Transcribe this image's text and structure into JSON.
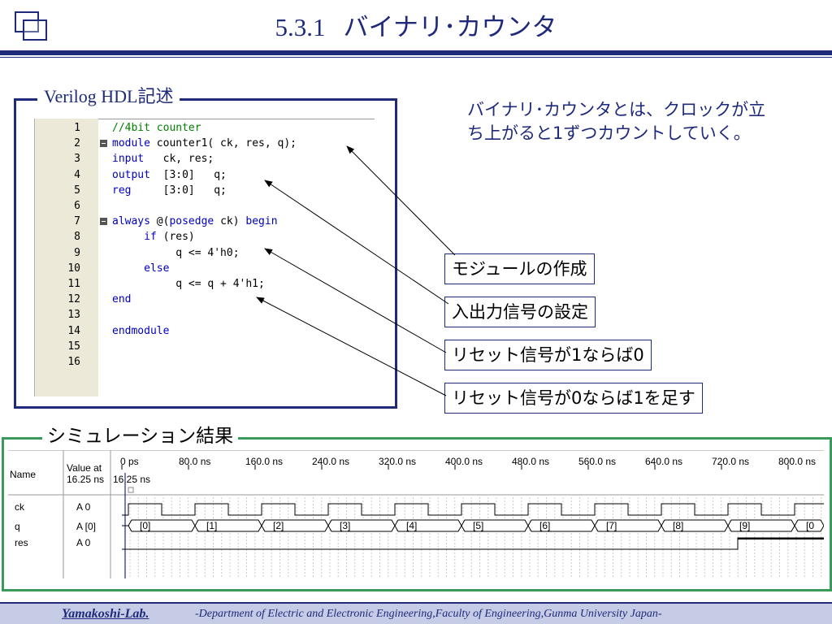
{
  "slide": {
    "number": "5.3.1",
    "title": "バイナリ･カウンタ"
  },
  "verilog_section": {
    "heading": "Verilog HDL記述",
    "lines": [
      {
        "num": "1",
        "parts": [
          {
            "t": "//4bit counter",
            "c": "cm"
          }
        ],
        "fold": false
      },
      {
        "num": "2",
        "parts": [
          {
            "t": "module",
            "c": "kw"
          },
          {
            "t": " counter1( ck, res, q);",
            "c": "tx"
          }
        ],
        "fold": true
      },
      {
        "num": "3",
        "parts": [
          {
            "t": "input",
            "c": "kw"
          },
          {
            "t": "   ck, res;",
            "c": "tx"
          }
        ],
        "fold": false
      },
      {
        "num": "4",
        "parts": [
          {
            "t": "output",
            "c": "kw"
          },
          {
            "t": "  [3:0]   q;",
            "c": "tx"
          }
        ],
        "fold": false
      },
      {
        "num": "5",
        "parts": [
          {
            "t": "reg",
            "c": "kw"
          },
          {
            "t": "     [3:0]   q;",
            "c": "tx"
          }
        ],
        "fold": false
      },
      {
        "num": "6",
        "parts": [],
        "fold": false
      },
      {
        "num": "7",
        "parts": [
          {
            "t": "always",
            "c": "kw"
          },
          {
            "t": " @(",
            "c": "tx"
          },
          {
            "t": "posedge",
            "c": "kw"
          },
          {
            "t": " ck) ",
            "c": "tx"
          },
          {
            "t": "begin",
            "c": "kw"
          }
        ],
        "fold": true
      },
      {
        "num": "8",
        "parts": [
          {
            "t": "     ",
            "c": "tx"
          },
          {
            "t": "if",
            "c": "kw"
          },
          {
            "t": " (res)",
            "c": "tx"
          }
        ],
        "fold": false
      },
      {
        "num": "9",
        "parts": [
          {
            "t": "          q <= 4'h0;",
            "c": "tx"
          }
        ],
        "fold": false
      },
      {
        "num": "10",
        "parts": [
          {
            "t": "     ",
            "c": "tx"
          },
          {
            "t": "else",
            "c": "kw"
          }
        ],
        "fold": false
      },
      {
        "num": "11",
        "parts": [
          {
            "t": "          q <= q + 4'h1;",
            "c": "tx"
          }
        ],
        "fold": false
      },
      {
        "num": "12",
        "parts": [
          {
            "t": "end",
            "c": "kw"
          }
        ],
        "fold": false
      },
      {
        "num": "13",
        "parts": [],
        "fold": false
      },
      {
        "num": "14",
        "parts": [
          {
            "t": "endmodule",
            "c": "kw"
          }
        ],
        "fold": false
      },
      {
        "num": "15",
        "parts": [],
        "fold": false
      },
      {
        "num": "16",
        "parts": [],
        "fold": false
      }
    ]
  },
  "description": "バイナリ･カウンタとは、クロックが立ち上がると1ずつカウントしていく。",
  "annotations": {
    "module": "モジュールの作成",
    "io": "入出力信号の設定",
    "reset1": "リセット信号が1ならば0",
    "reset0": "リセット信号が0ならば1を足す"
  },
  "simulation": {
    "heading": "シミュレーション結果",
    "col_name": "Name",
    "col_value": "Value at\n16.25 ns",
    "cursor_time": "16.25 ns",
    "time_ticks": [
      "0 ps",
      "80.0 ns",
      "160.0 ns",
      "240.0 ns",
      "320.0 ns",
      "400.0 ns",
      "480.0 ns",
      "560.0 ns",
      "640.0 ns",
      "720.0 ns",
      "800.0 ns"
    ],
    "signals": [
      {
        "name": "ck",
        "value": "A 0"
      },
      {
        "name": "q",
        "value": "A [0]"
      },
      {
        "name": "res",
        "value": "A 0"
      }
    ],
    "q_values": [
      "[0]",
      "[1]",
      "[2]",
      "[3]",
      "[4]",
      "[5]",
      "[6]",
      "[7]",
      "[8]",
      "[9]",
      "[0"
    ]
  },
  "footer": {
    "lab": "Yamakoshi-Lab.",
    "dept": "-Department of Electric and Electronic Engineering,Faculty of Engineering,Gunma University Japan-"
  },
  "colors": {
    "navy": "#1f2a7a",
    "green_frame": "#3a9a5c",
    "keyword": "#0000c0",
    "comment": "#008000"
  }
}
